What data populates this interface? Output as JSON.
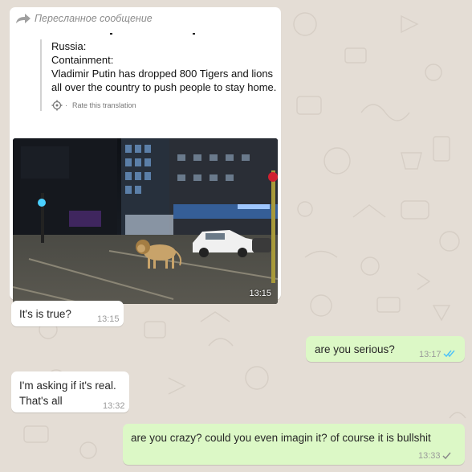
{
  "forwarded_message": {
    "label": "Пересланное сообщение",
    "tweet_text": "Russia:\nContainment:\nVladimir Putin has dropped 800 Tigers and lions all over the country to push people to stay home.",
    "translate_label": "Rate this translation",
    "photo_time": "13:15"
  },
  "messages": [
    {
      "direction": "incoming",
      "text": "It's is true?",
      "time": "13:15"
    },
    {
      "direction": "outgoing",
      "text": "are you serious?",
      "time": "13:17",
      "status": "read"
    },
    {
      "direction": "incoming",
      "text": "I'm asking if it's real.\nThat's all",
      "time": "13:32"
    },
    {
      "direction": "outgoing",
      "text": "are you crazy? could you even imagin it? of course it is bullshit",
      "time": "13:33",
      "status": "delivered"
    }
  ],
  "colors": {
    "background": "#e4ddd5",
    "incoming_bubble": "#ffffff",
    "outgoing_bubble": "#dcf8c6",
    "read_ticks": "#4fc3f7",
    "delivered_ticks": "#8a8a8a"
  },
  "icons": [
    "forward-arrow-icon",
    "translate-gear-icon",
    "double-check-read-icon",
    "single-check-icon"
  ]
}
